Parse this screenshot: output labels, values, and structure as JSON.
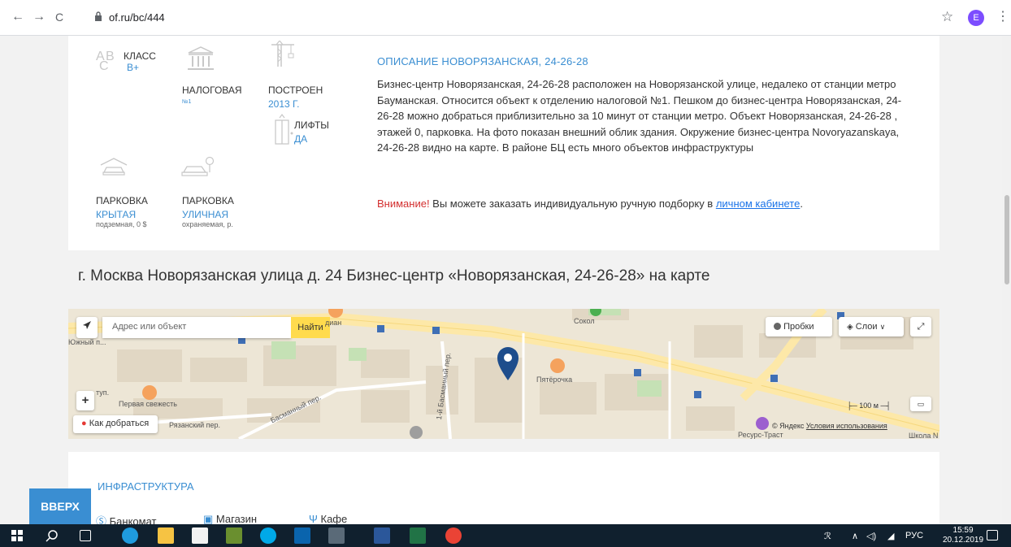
{
  "browser": {
    "back": "←",
    "forward": "→",
    "reload": "C",
    "url": "of.ru/bc/444",
    "star": "☆",
    "avatar_letter": "E",
    "menu": "⋮"
  },
  "features": {
    "class": {
      "label": "КЛАСС",
      "value": "В+",
      "icon": "abc-class-icon"
    },
    "tax": {
      "label": "НАЛОГОВАЯ",
      "sub": "№1",
      "icon": "tax-building-icon"
    },
    "built": {
      "label": "ПОСТРОЕН",
      "value": "2013 Г.",
      "icon": "crane-icon"
    },
    "lifts": {
      "label": "ЛИФТЫ",
      "value": "ДА",
      "icon": "elevator-icon"
    },
    "parking_covered": {
      "label": "ПАРКОВКА",
      "value": "КРЫТАЯ",
      "sub": "подземная, 0 $",
      "icon": "covered-parking-icon"
    },
    "parking_street": {
      "label": "ПАРКОВКА",
      "value": "УЛИЧНАЯ",
      "sub": "охраняемая, р.",
      "icon": "street-parking-icon"
    }
  },
  "description": {
    "title": "ОПИСАНИЕ НОВОРЯЗАНСКАЯ, 24-26-28",
    "text": "Бизнес-центр Новорязанская, 24-26-28 расположен на Новорязанской улице, недалеко от станции метро Бауманская. Относится объект к отделению налоговой №1. Пешком до бизнес-центра Новорязанская, 24-26-28 можно добраться приблизительно за 10 минут от станции метро. Объект Новорязанская, 24-26-28 , этажей 0, парковка. На фото показан внешний облик здания. Окружение бизнес-центра Novoryazanskaya, 24-26-28 видно на карте. В районе БЦ есть много объектов инфраструктуры",
    "notice_warn": "Внимание!",
    "notice_text": " Вы можете заказать индивидуальную ручную подборку в ",
    "notice_link": "личном кабинете",
    "notice_end": "."
  },
  "map_heading": "г. Москва Новорязанская улица д. 24 Бизнес-центр «Новорязанская, 24-26-28» на карте",
  "map": {
    "search_placeholder": "Адрес или объект",
    "find_label": "Найти",
    "traffic_label": "Пробки",
    "layers_label": "Слои",
    "route_label": "Как добраться",
    "zoom_in": "+",
    "scale_label": "100 м",
    "copyright_prefix": "© Яндекс ",
    "copyright_link": "Условия использования",
    "labels": {
      "sokol": "Сокол",
      "pyaterochka": "Пятёрочка",
      "pervaya_svezhest": "Первая свежесть",
      "ryazanskiy": "Рязанский пер.",
      "basmanny": "Басманный пер.",
      "first_basmanny": "1-й Басманный пер.",
      "resurs_trast": "Ресурс-Траст",
      "yuzhny": "Южный п...",
      "tup": "туп.",
      "dian": "диан",
      "shkola": "Школа N"
    }
  },
  "infrastructure": {
    "title": "ИНФРАСТРУКТУРА",
    "items": [
      {
        "label": "Банкомат",
        "icon": "atm-icon"
      },
      {
        "label": "Магазин",
        "icon": "shop-icon"
      },
      {
        "label": "Кафе",
        "icon": "cafe-icon"
      }
    ]
  },
  "up_button": "ВВЕРХ",
  "taskbar": {
    "lang": "РУС",
    "time": "15:59",
    "date": "20.12.2019"
  }
}
